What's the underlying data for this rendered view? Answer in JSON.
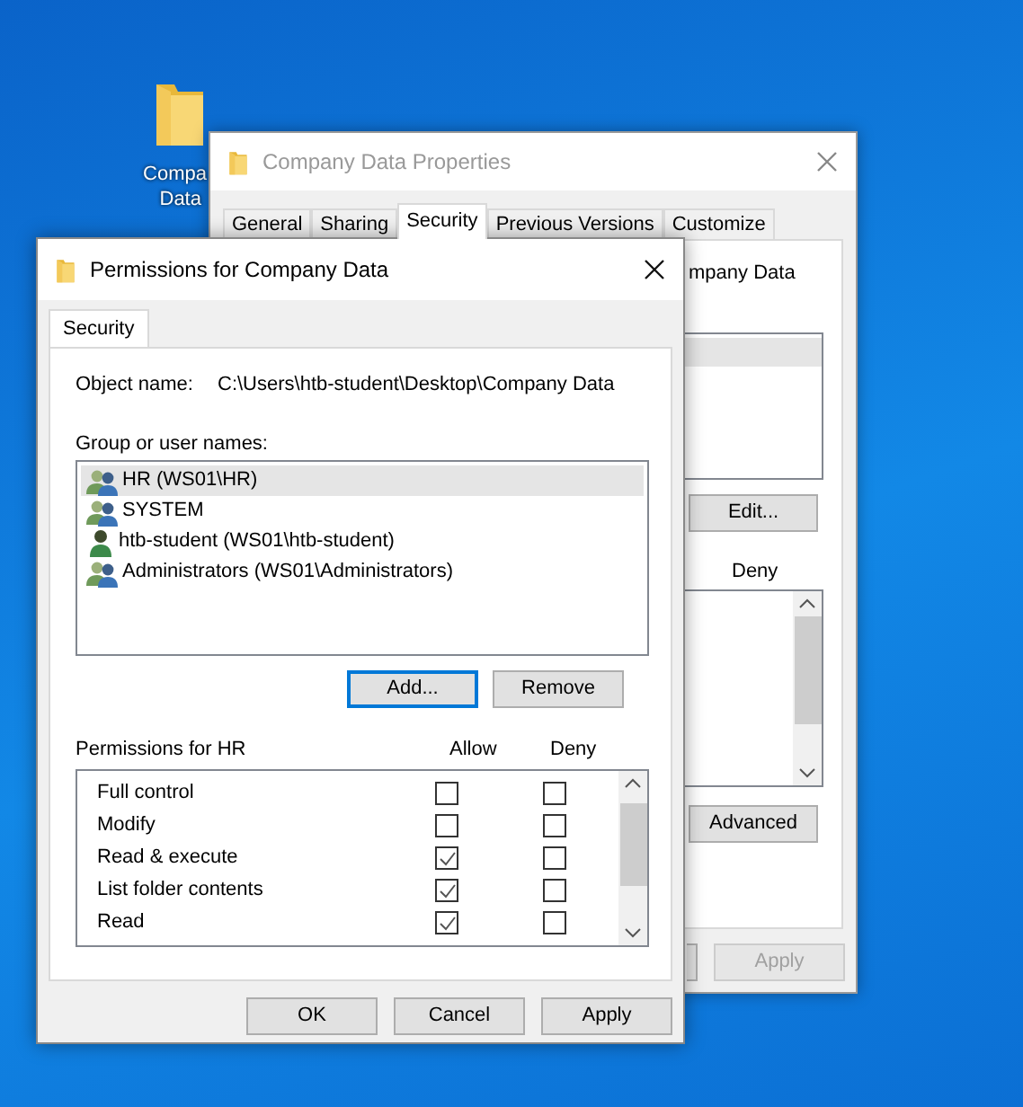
{
  "desktop": {
    "icon_label_lines": [
      "Compa",
      "Data"
    ]
  },
  "properties_window": {
    "title": "Company Data Properties",
    "active": false,
    "tabs": [
      {
        "label": "General",
        "selected": false
      },
      {
        "label": "Sharing",
        "selected": false
      },
      {
        "label": "Security",
        "selected": true
      },
      {
        "label": "Previous Versions",
        "selected": false
      },
      {
        "label": "Customize",
        "selected": false
      }
    ],
    "object_name_fragment": "mpany Data",
    "edit_button": "Edit...",
    "deny_header": "Deny",
    "advanced_button": "Advanced",
    "apply_button": {
      "label": "Apply",
      "disabled": true
    }
  },
  "permissions_window": {
    "title": "Permissions for Company Data",
    "active": true,
    "tabs": [
      {
        "label": "Security",
        "selected": true
      }
    ],
    "object_name_label": "Object name:",
    "object_name": "C:\\Users\\htb-student\\Desktop\\Company Data",
    "group_label": "Group or user names:",
    "principals": [
      {
        "name": "HR (WS01\\HR)",
        "kind": "group",
        "selected": true
      },
      {
        "name": "SYSTEM",
        "kind": "group",
        "selected": false
      },
      {
        "name": "htb-student (WS01\\htb-student)",
        "kind": "user",
        "selected": false
      },
      {
        "name": "Administrators (WS01\\Administrators)",
        "kind": "group",
        "selected": false
      }
    ],
    "buttons": [
      {
        "label": "Add...",
        "focused": true
      },
      {
        "label": "Remove",
        "focused": false
      }
    ],
    "permissions_label": "Permissions for HR",
    "allow_header": "Allow",
    "deny_header": "Deny",
    "permissions": [
      {
        "name": "Full control",
        "allow": false,
        "deny": false
      },
      {
        "name": "Modify",
        "allow": false,
        "deny": false
      },
      {
        "name": "Read & execute",
        "allow": true,
        "deny": false
      },
      {
        "name": "List folder contents",
        "allow": true,
        "deny": false
      },
      {
        "name": "Read",
        "allow": true,
        "deny": false
      }
    ],
    "footer_buttons": [
      "OK",
      "Cancel",
      "Apply"
    ]
  }
}
